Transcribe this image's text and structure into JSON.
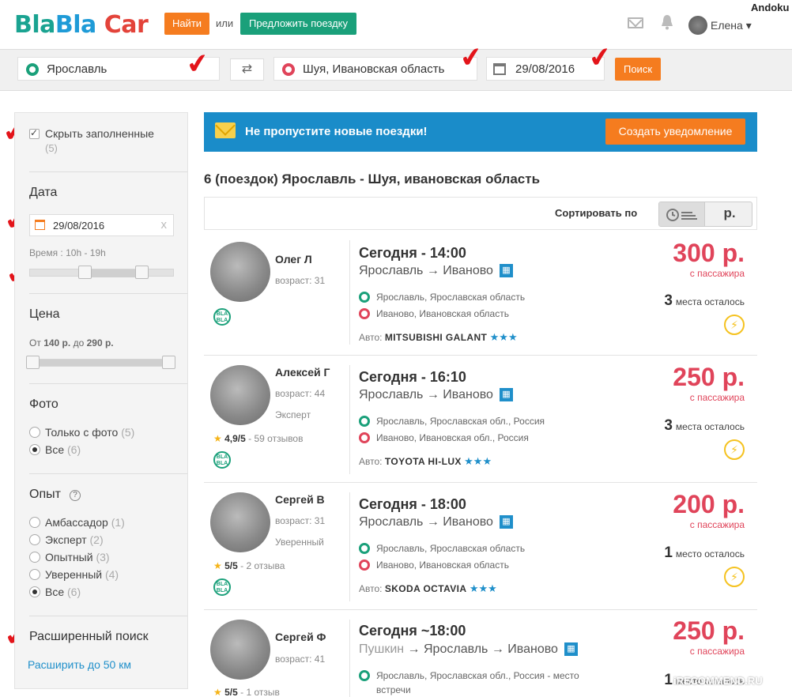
{
  "header": {
    "logo": {
      "part1": "Bla",
      "part2": "Bla",
      "part3": "Car"
    },
    "find_button": "Найти",
    "or_text": "или",
    "offer_button": "Предложить поездку",
    "user_name": "Елена ▾",
    "corner_label": "Andoku"
  },
  "search": {
    "from": "Ярославль",
    "to": "Шуя, Ивановская область",
    "date": "29/08/2016",
    "search_button": "Поиск"
  },
  "sidebar": {
    "hide_full_label": "Скрыть заполненные",
    "hide_full_count": "(5)",
    "date_title": "Дата",
    "date_value": "29/08/2016",
    "date_clear": "x",
    "time_label": "Время :  10h - 19h",
    "price_title": "Цена",
    "price_range_prefix": "От",
    "price_from": "140 р.",
    "price_mid": "до",
    "price_to": "290 р.",
    "photo_title": "Фото",
    "photo_options": [
      {
        "label": "Только с фото",
        "count": "(5)"
      },
      {
        "label": "Все",
        "count": "(6)"
      }
    ],
    "experience_title": "Опыт",
    "experience_help": "?",
    "experience_options": [
      {
        "label": "Амбассадор",
        "count": "(1)"
      },
      {
        "label": "Эксперт",
        "count": "(2)"
      },
      {
        "label": "Опытный",
        "count": "(3)"
      },
      {
        "label": "Уверенный",
        "count": "(4)"
      },
      {
        "label": "Все",
        "count": "(6)"
      }
    ],
    "advanced_title": "Расширенный поиск",
    "extend_link": "Расширить до 50 км"
  },
  "banner": {
    "text": "Не пропустите новые поездки!",
    "button": "Создать уведомление"
  },
  "results": {
    "title": "6 (поездок) Ярославль - Шуя, ивановская область",
    "sort_label": "Сортировать по",
    "sort_price": "р."
  },
  "trips": [
    {
      "driver": "Олег Л",
      "age": "возраст: 31",
      "level": "",
      "rating": "",
      "reviews": "",
      "time": "Сегодня - 14:00",
      "route_from": "",
      "route_a": "Ярославль",
      "route_b": "Иваново",
      "stop_from": "Ярославль, Ярославская область",
      "stop_to": "Иваново, Ивановская область",
      "car_label": "Авто:",
      "car": "MITSUBISHI GALANT",
      "price": "300 р.",
      "per_passenger": "с пассажира",
      "seats_num": "3",
      "seats_text": "места осталось"
    },
    {
      "driver": "Алексей Г",
      "age": "возраст: 44",
      "level": "Эксперт",
      "rating": "4,9/5",
      "reviews": " - 59 отзывов",
      "time": "Сегодня - 16:10",
      "route_from": "",
      "route_a": "Ярославль",
      "route_b": "Иваново",
      "stop_from": "Ярославль, Ярославская обл., Россия",
      "stop_to": "Иваново, Ивановская обл., Россия",
      "car_label": "Авто:",
      "car": "TOYOTA HI-LUX",
      "price": "250 р.",
      "per_passenger": "с пассажира",
      "seats_num": "3",
      "seats_text": "места осталось"
    },
    {
      "driver": "Сергей В",
      "age": "возраст: 31",
      "level": "Уверенный",
      "rating": "5/5",
      "reviews": " - 2 отзыва",
      "time": "Сегодня - 18:00",
      "route_from": "",
      "route_a": "Ярославль",
      "route_b": "Иваново",
      "stop_from": "Ярославль, Ярославская область",
      "stop_to": "Иваново, Ивановская область",
      "car_label": "Авто:",
      "car": "SKODA OCTAVIA",
      "price": "200 р.",
      "per_passenger": "с пассажира",
      "seats_num": "1",
      "seats_text": "место осталось"
    },
    {
      "driver": "Сергей Ф",
      "age": "возраст: 41",
      "level": "",
      "rating": "5/5",
      "reviews": " - 1 отзыв",
      "time": "Сегодня ~18:00",
      "route_from": "Пушкин",
      "route_a": "Ярославль",
      "route_b": "Иваново",
      "stop_from": "Ярославль, Ярославская обл., Россия - место",
      "stop_from_2": "встречи",
      "car_label": "",
      "car": "",
      "price": "250 р.",
      "per_passenger": "с пассажира",
      "seats_num": "1",
      "seats_text": "место осталось"
    }
  ],
  "watermark": "iRECOMMEND.RU",
  "colors": {
    "accent_orange": "#f57c1f",
    "accent_green": "#1aa07a",
    "price_red": "#e0445a",
    "banner_blue": "#1a8cc9"
  }
}
